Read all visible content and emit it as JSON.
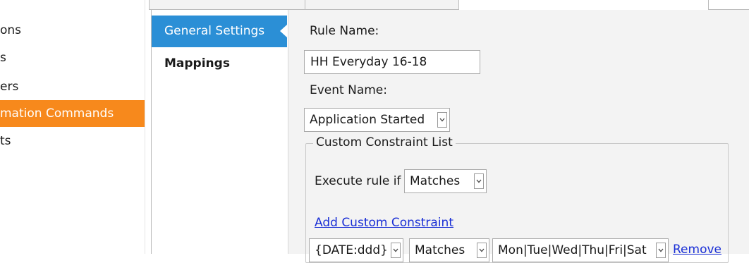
{
  "left_nav": {
    "items": [
      {
        "label": "ons",
        "selected": false
      },
      {
        "label": "s",
        "selected": false
      },
      {
        "label": "ers",
        "selected": false
      },
      {
        "label": "mation Commands",
        "selected": true
      },
      {
        "label": "ts",
        "selected": false
      }
    ]
  },
  "settings_tabs": [
    {
      "label": "General Settings",
      "active": true
    },
    {
      "label": "Mappings",
      "active": false
    }
  ],
  "form": {
    "rule_name_label": "Rule Name:",
    "rule_name_value": "HH Everyday 16-18",
    "event_name_label": "Event Name:",
    "event_name_value": "Application Started",
    "constraint_group_title": "Custom Constraint List",
    "execute_rule_label": "Execute rule if",
    "execute_rule_value": "Matches",
    "add_constraint_link": "Add Custom Constraint",
    "constraint_row": {
      "field_value": "{DATE:ddd}",
      "operator_value": "Matches",
      "pattern_value": "Mon|Tue|Wed|Thu|Fri|Sat",
      "remove_link": "Remove"
    }
  },
  "colors": {
    "accent_orange": "#f7891c",
    "tab_blue": "#2b8fd6",
    "link_blue": "#1a2fd6",
    "panel_gray": "#f3f3f3"
  },
  "icons": {
    "dropdown": "chevron-down-icon"
  }
}
